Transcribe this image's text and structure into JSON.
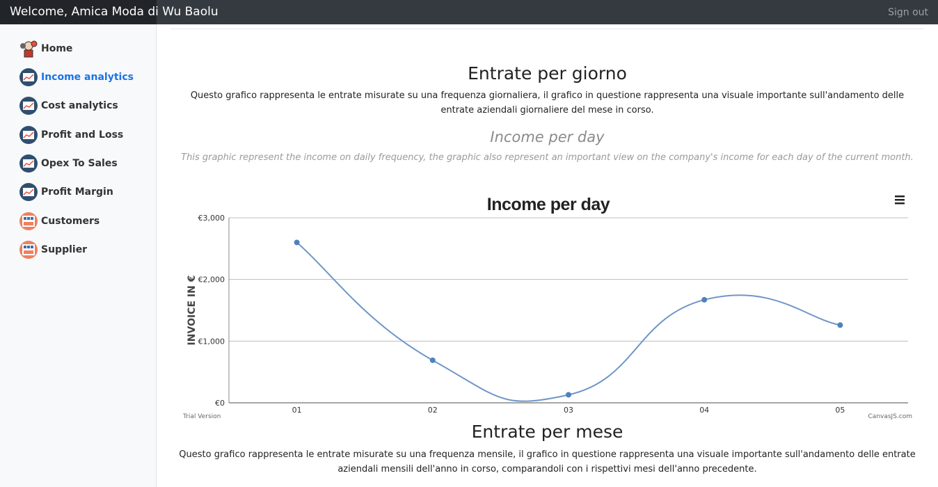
{
  "header": {
    "brand": "Welcome, Amica Moda di Wu Baolu",
    "signout": "Sign out"
  },
  "sidebar": {
    "items": [
      {
        "label": "Home",
        "icon": "home-avatar-icon"
      },
      {
        "label": "Income analytics",
        "icon": "chart-icon",
        "active": true
      },
      {
        "label": "Cost analytics",
        "icon": "chart-icon"
      },
      {
        "label": "Profit and Loss",
        "icon": "chart-icon"
      },
      {
        "label": "Opex To Sales",
        "icon": "chart-icon"
      },
      {
        "label": "Profit Margin",
        "icon": "chart-icon"
      },
      {
        "label": "Customers",
        "icon": "people-icon"
      },
      {
        "label": "Supplier",
        "icon": "people-icon"
      }
    ]
  },
  "section_day": {
    "title": "Entrate per giorno",
    "desc": "Questo grafico rappresenta le entrate misurate su una frequenza giornaliera, il grafico in questione rappresenta una visuale importante sull'andamento delle entrate aziendali giornaliere del mese in corso.",
    "title_en": "Income per day",
    "desc_en": "This graphic represent the income on daily frequency, the graphic also represent an important view on the company's income for each day of the current month."
  },
  "chart_data": {
    "type": "line",
    "title": "Income per day",
    "ylabel": "INVOICE IN €",
    "xlabel": "",
    "categories": [
      "01",
      "02",
      "03",
      "04",
      "05"
    ],
    "values": [
      2600,
      690,
      130,
      1670,
      1260
    ],
    "ylim": [
      0,
      3000
    ],
    "yticks": [
      "€0",
      "€1,000",
      "€2,000",
      "€3,000"
    ],
    "grid": true,
    "smooth": true,
    "line_color": "#6d96c9",
    "watermark_left": "Trial Version",
    "watermark_right": "CanvasJS.com"
  },
  "section_month": {
    "title": "Entrate per mese",
    "desc": "Questo grafico rappresenta le entrate misurate su una frequenza mensile, il grafico in questione rappresenta una visuale importante sull'andamento delle entrate aziendali mensili dell'anno in corso, comparandoli con i rispettivi mesi dell'anno precedente."
  }
}
